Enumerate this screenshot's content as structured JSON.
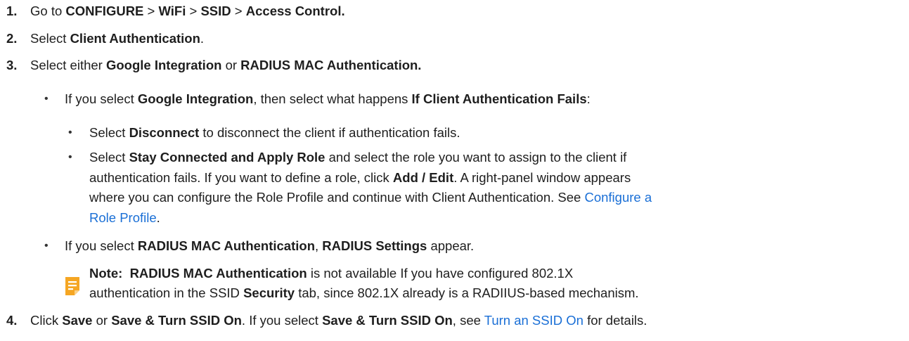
{
  "steps": {
    "s1": {
      "num": "1.",
      "t1": "Go to ",
      "b1": "CONFIGURE",
      "t2": " > ",
      "b2": "WiFi",
      "t3": " > ",
      "b3": "SSID",
      "t4": " > ",
      "b4": "Access Control."
    },
    "s2": {
      "num": "2.",
      "t1": "Select ",
      "b1": "Client Authentication",
      "t2": "."
    },
    "s3": {
      "num": "3.",
      "t1": "Select either ",
      "b1": "Google Integration",
      "t2": " or ",
      "b2": "RADIUS MAC Authentication."
    },
    "s4": {
      "num": "4.",
      "t1": "Click ",
      "b1": "Save",
      "t2": " or ",
      "b2": "Save & Turn SSID On",
      "t3": ". If you select ",
      "b3": "Save & Turn SSID On",
      "t4": ", see ",
      "link": "Turn an SSID On",
      "t5": " for details."
    }
  },
  "bullets": {
    "google": {
      "t1": "If you select ",
      "b1": "Google Integration",
      "t2": ", then select what happens ",
      "b2": "If Client Authentication Fails",
      "t3": ":"
    },
    "disconnect": {
      "t1": "Select ",
      "b1": "Disconnect",
      "t2": " to disconnect the client if authentication fails."
    },
    "stay": {
      "t1": "Select ",
      "b1": "Stay Connected and Apply Role",
      "t2": " and select the role you want to assign to the client if",
      "l2a": "authentication fails. If you want to define a role, click ",
      "l2b": "Add / Edit",
      "l2c": ". A right-panel window appears",
      "l3a": "where you can configure the Role Profile and continue with Client Authentication. See ",
      "l3link": "Configure a",
      "l4link": "Role Profile",
      "l4b": "."
    },
    "radius": {
      "t1": "If you select ",
      "b1": "RADIUS MAC Authentication",
      "t2": ", ",
      "b2": "RADIUS Settings",
      "t3": " appear."
    }
  },
  "note": {
    "label": "Note:  ",
    "b1": "RADIUS MAC Authentication",
    "t1": " is not available If you have configured 802.1X",
    "l2a": "authentication in the SSID ",
    "l2b": "Security",
    "l2c": " tab, since 802.1X already is a RADIIUS-based mechanism."
  },
  "bullet_char": "•",
  "colors": {
    "link": "#1a6fd6",
    "note_icon": "#f5a623"
  },
  "icons": {
    "note": "note-icon"
  }
}
